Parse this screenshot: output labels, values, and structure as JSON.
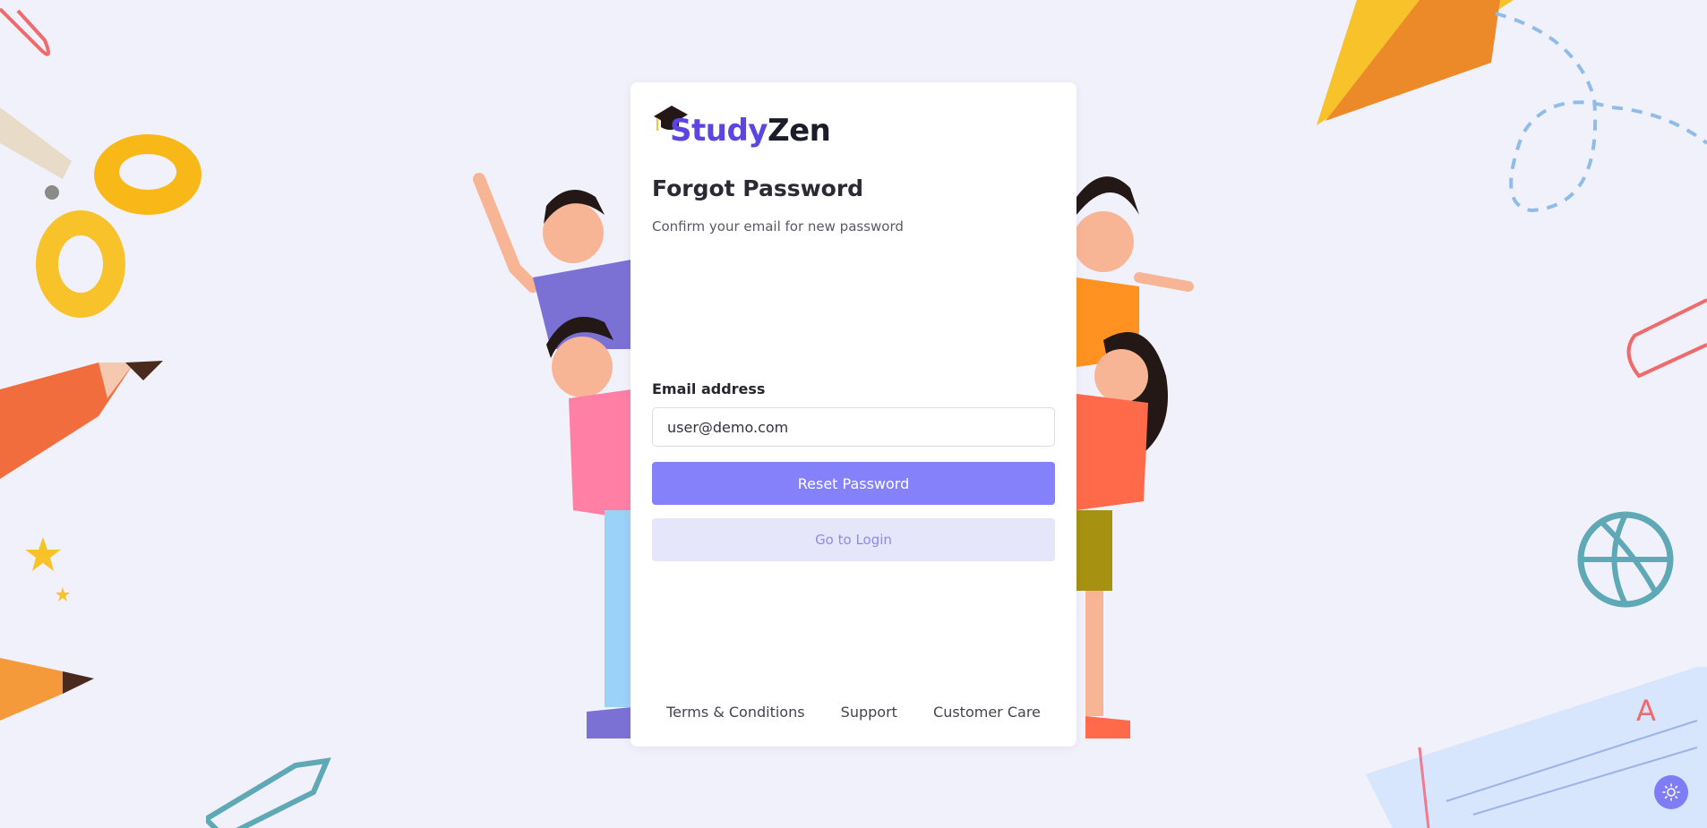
{
  "brand": {
    "name_part1": "Study",
    "name_part2": "Zen"
  },
  "page": {
    "title": "Forgot Password",
    "subtitle": "Confirm your email for new password"
  },
  "form": {
    "email_label": "Email address",
    "email_value": "user@demo.com",
    "reset_button": "Reset Password",
    "login_button": "Go to Login"
  },
  "footer": {
    "links": [
      "Terms & Conditions",
      "Support",
      "Customer Care"
    ]
  },
  "colors": {
    "accent": "#8481fb",
    "brand_purple": "#5b46e3",
    "background": "#f1f1fb"
  },
  "icons": {
    "theme_toggle": "sun-icon",
    "logo": "graduation-cap-icon"
  }
}
